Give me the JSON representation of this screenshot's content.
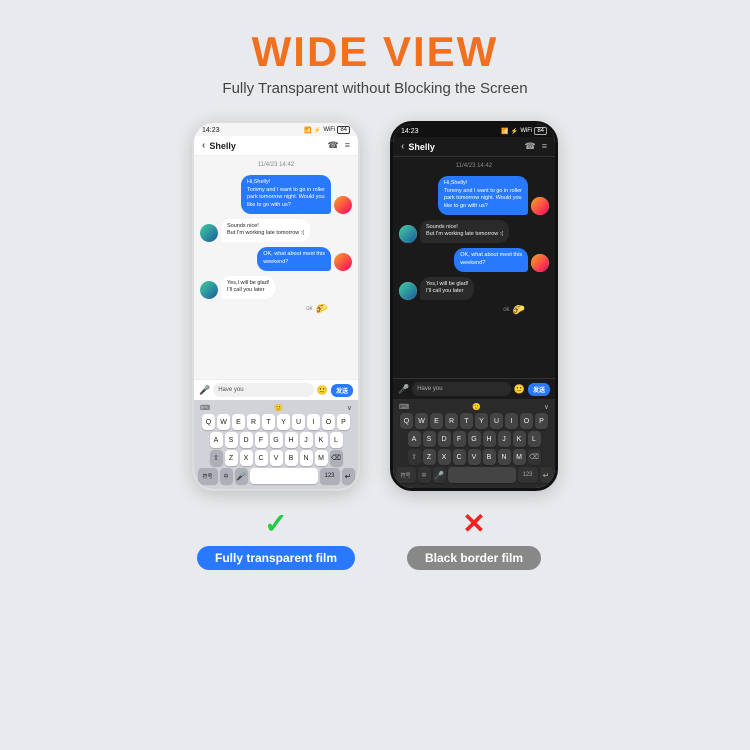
{
  "header": {
    "title": "WIDE VIEW",
    "subtitle": "Fully Transparent without Blocking the Screen"
  },
  "phone_left": {
    "status_time": "14:23",
    "status_icons": "📶⚡WiFi",
    "contact": "Shelly",
    "date_divider": "11/4/23 14:42",
    "messages": [
      {
        "type": "sent",
        "text": "Hi,Shelly!\nTommy and I want to go in roller\npark tomorrow night. Would you\nlike to go with us?"
      },
      {
        "type": "recv",
        "text": "Sounds nice!\nBut I'm working late tomorrow :("
      },
      {
        "type": "sent",
        "text": "OK, what about meet this\nweekend?"
      },
      {
        "type": "recv",
        "text": "Yes,I will be glad!\nI'll call you later"
      }
    ],
    "ok_text": "ok",
    "input_text": "Have you"
  },
  "phone_right": {
    "status_time": "14:23",
    "contact": "Shelly",
    "date_divider": "11/4/23 14:42",
    "messages": [
      {
        "type": "sent",
        "text": "Hi,Shelly!\nTommy and I want to go in roller\npark tomorrow night. Would you\nlike to go with us?"
      },
      {
        "type": "recv",
        "text": "Sounds nice!\nBut I'm working late tomorrow :("
      },
      {
        "type": "sent",
        "text": "OK, what about meet this\nweekend?"
      },
      {
        "type": "recv",
        "text": "Yes,I will be glad!\nI'll call you later"
      }
    ],
    "ok_text": "ok",
    "input_text": "Have you"
  },
  "label_left": {
    "check": "✓",
    "text": "Fully transparent film"
  },
  "label_right": {
    "cross": "✕",
    "text": "Black border film"
  },
  "keyboard_rows": [
    [
      "Q",
      "W",
      "E",
      "R",
      "T",
      "Y",
      "U",
      "I",
      "O",
      "P"
    ],
    [
      "A",
      "S",
      "D",
      "F",
      "G",
      "H",
      "J",
      "K",
      "L"
    ],
    [
      "Z",
      "X",
      "C",
      "V",
      "B",
      "N",
      "M"
    ]
  ],
  "kb_bottom": [
    "符号",
    "中",
    "🎤",
    "_space_",
    "123",
    "↵"
  ],
  "send_label": "发送"
}
